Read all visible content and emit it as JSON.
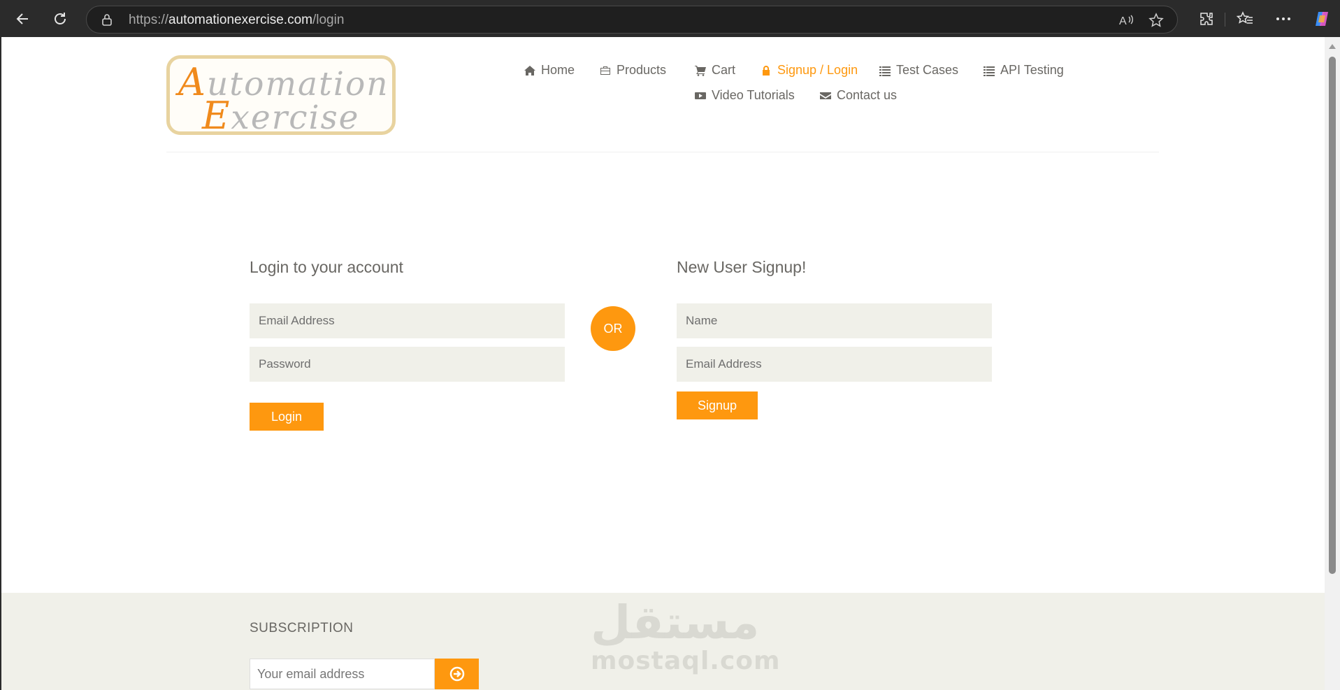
{
  "browser": {
    "url_scheme": "https://",
    "url_host": "automationexercise.com",
    "url_path": "/login",
    "back_icon": "back-arrow-icon",
    "refresh_icon": "refresh-icon",
    "read_aloud_icon": "read-aloud-icon",
    "favorite_icon": "star-icon",
    "extensions_icon": "puzzle-icon",
    "favorites_icon": "favorites-icon",
    "menu_icon": "more-icon",
    "copilot_icon": "copilot-icon"
  },
  "logo": {
    "line1_cap": "A",
    "line1_rest": "utomation",
    "line2_cap": "E",
    "line2_rest": "xercise"
  },
  "nav": {
    "items": [
      {
        "label": "Home",
        "icon": "home-icon"
      },
      {
        "label": "Products",
        "icon": "briefcase-icon"
      },
      {
        "label": "Cart",
        "icon": "cart-icon"
      },
      {
        "label": "Signup / Login",
        "icon": "lock-icon",
        "active": true
      },
      {
        "label": "Test Cases",
        "icon": "list-icon"
      },
      {
        "label": "API Testing",
        "icon": "list-icon"
      },
      {
        "label": "Video Tutorials",
        "icon": "youtube-icon"
      },
      {
        "label": "Contact us",
        "icon": "envelope-icon"
      }
    ]
  },
  "login": {
    "title": "Login to your account",
    "email_placeholder": "Email Address",
    "password_placeholder": "Password",
    "button": "Login"
  },
  "or_label": "OR",
  "signup": {
    "title": "New User Signup!",
    "name_placeholder": "Name",
    "email_placeholder": "Email Address",
    "button": "Signup"
  },
  "footer": {
    "subscription_title": "SUBSCRIPTION",
    "email_placeholder": "Your email address",
    "submit_icon": "arrow-circle-right-icon",
    "watermark_arabic": "مستقل",
    "watermark_latin": "mostaql.com"
  },
  "colors": {
    "accent": "#fe980f",
    "text": "#696763",
    "field_bg": "#f0f0e9"
  }
}
